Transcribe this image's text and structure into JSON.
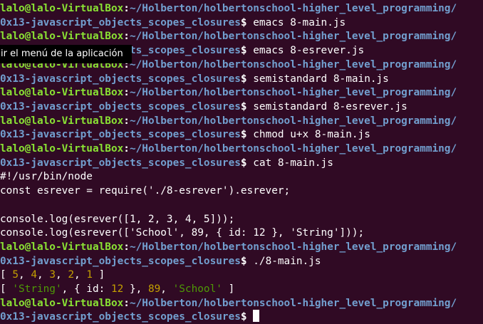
{
  "prompt": {
    "user_host": "lalo@lalo-VirtualBox",
    "colon": ":",
    "path_line1": "~/Holberton/holbertonschool-higher_level_programming/",
    "path_line2": "0x13-javascript_objects_scopes_closures",
    "dollar": "$"
  },
  "commands": [
    " emacs 8-main.js",
    " emacs 8-esrever.js",
    " semistandard 8-main.js",
    " semistandard 8-esrever.js",
    " chmod u+x 8-main.js",
    " cat 8-main.js",
    " ./8-main.js",
    " "
  ],
  "file_contents": [
    "#!/usr/bin/node",
    "const esrever = require('./8-esrever').esrever;",
    "",
    "console.log(esrever([1, 2, 3, 4, 5]));",
    "console.log(esrever(['School', 89, { id: 12 }, 'String']));"
  ],
  "output": {
    "line1": {
      "open": "[ ",
      "n1": "5",
      "c1": ", ",
      "n2": "4",
      "c2": ", ",
      "n3": "3",
      "c3": ", ",
      "n4": "2",
      "c4": ", ",
      "n5": "1",
      "close": " ]"
    },
    "line2": {
      "open": "[ ",
      "s1": "'String'",
      "mid1": ", { id: ",
      "n1": "12",
      "mid2": " }, ",
      "n2": "89",
      "c1": ", ",
      "s2": "'School'",
      "close": " ]"
    }
  },
  "tooltip": {
    "text": "ir el menú de la aplicación"
  },
  "colors": {
    "background": "#300a24",
    "user_host": "#8ae234",
    "path": "#729fcf",
    "number": "#c4a000",
    "string": "#4e9a06"
  }
}
